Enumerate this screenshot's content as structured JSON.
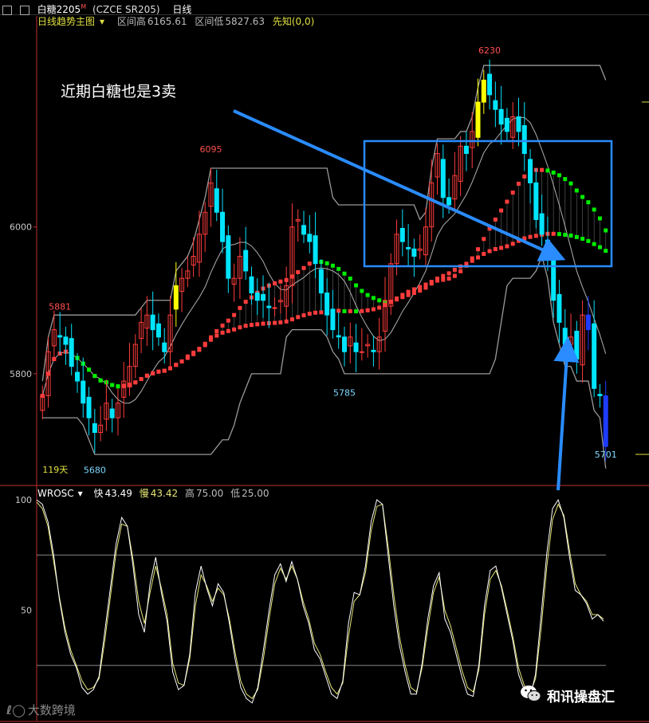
{
  "topbar": {
    "icons": [
      "grid-icon",
      "list-icon"
    ],
    "symbol": "白糖2205",
    "superscript": "M",
    "code": "(CZCE SR205)",
    "period": "日线"
  },
  "main_legend": {
    "indicator": "日线趋势主图",
    "range_high_label": "区间高",
    "range_high": "6165.61",
    "range_low_label": "区间低",
    "range_low": "5827.63",
    "extra": "先知(0,0)"
  },
  "headline": "近期白糖也是3卖",
  "osc_legend": {
    "name": "WROSC",
    "fast_label": "快",
    "fast": "43.49",
    "slow_label": "慢",
    "slow": "43.42",
    "high_label": "高",
    "high": "75.00",
    "low_label": "低",
    "low": "25.00"
  },
  "watermark": "和讯操盘汇",
  "watermark_small": "大数跨境",
  "colors": {
    "up": "#ff3c3c",
    "down": "#00e5ff",
    "yellow": "#ffff00",
    "blue_bar": "#1e3cff",
    "green": "#00ee00",
    "gray": "#a0a0a0",
    "box": "#2a8cff",
    "osc_fast": "#ffffff",
    "osc_slow": "#e6e678"
  },
  "chart_data": [
    {
      "type": "candlestick",
      "ylim": [
        5650,
        6270
      ],
      "y_ticks": [
        {
          "v": 6000,
          "label": "6000"
        },
        {
          "v": 5800,
          "label": "5800"
        }
      ],
      "annotations": [
        {
          "text": "6230",
          "i": 77,
          "v": 6230,
          "side": "top"
        },
        {
          "text": "6095",
          "i": 29,
          "v": 6095,
          "side": "top"
        },
        {
          "text": "5881",
          "i": 3,
          "v": 5881,
          "side": "top"
        },
        {
          "text": "5785",
          "i": 52,
          "v": 5785,
          "side": "bottom"
        },
        {
          "text": "5680",
          "i": 9,
          "v": 5680,
          "side": "bottom"
        },
        {
          "text": "5701",
          "i": 97,
          "v": 5701,
          "side": "bottom"
        },
        {
          "text": "119天",
          "i": 0,
          "v": 5665,
          "side": "raw"
        }
      ],
      "closes": [
        5770,
        5830,
        5860,
        5850,
        5840,
        5810,
        5790,
        5760,
        5740,
        5720,
        5730,
        5760,
        5740,
        5760,
        5790,
        5810,
        5840,
        5870,
        5880,
        5860,
        5850,
        5830,
        5880,
        5920,
        5930,
        5940,
        5960,
        5990,
        6020,
        6060,
        6020,
        5980,
        5930,
        5930,
        5960,
        5940,
        5910,
        5900,
        5900,
        5890,
        5890,
        5900,
        5920,
        6000,
        6010,
        5990,
        5980,
        5950,
        5910,
        5880,
        5860,
        5850,
        5830,
        5850,
        5830,
        5830,
        5840,
        5830,
        5850,
        5900,
        5950,
        5990,
        5980,
        5970,
        5960,
        5970,
        6000,
        6060,
        6100,
        6040,
        6030,
        6070,
        6110,
        6100,
        6130,
        6170,
        6200,
        6180,
        6160,
        6140,
        6130,
        6150,
        6130,
        6100,
        6060,
        6010,
        5990,
        5960,
        5900,
        5870,
        5840,
        5850,
        5820,
        5880,
        5860,
        5780,
        5770,
        5701
      ]
    },
    {
      "type": "line",
      "ylim": [
        0,
        100
      ],
      "y_ticks": [
        {
          "v": 100,
          "label": "100"
        },
        {
          "v": 50,
          "label": "50"
        }
      ],
      "hlines": [
        75,
        25
      ],
      "series": [
        {
          "name": "快",
          "values": [
            100,
            98,
            90,
            75,
            55,
            40,
            30,
            24,
            15,
            12,
            14,
            20,
            40,
            60,
            80,
            92,
            88,
            70,
            48,
            40,
            62,
            74,
            58,
            45,
            22,
            14,
            16,
            30,
            58,
            70,
            60,
            52,
            62,
            58,
            44,
            28,
            15,
            10,
            8,
            15,
            32,
            50,
            66,
            71,
            63,
            72,
            64,
            52,
            44,
            32,
            28,
            20,
            12,
            10,
            18,
            44,
            58,
            57,
            70,
            90,
            100,
            98,
            75,
            52,
            34,
            22,
            12,
            12,
            26,
            46,
            61,
            67,
            46,
            40,
            30,
            20,
            12,
            11,
            25,
            52,
            68,
            70,
            60,
            48,
            36,
            21,
            14,
            10,
            21,
            48,
            76,
            96,
            100,
            92,
            74,
            59,
            57,
            53,
            46,
            48,
            45
          ]
        },
        {
          "name": "慢",
          "values": [
            99,
            96,
            88,
            72,
            56,
            42,
            32,
            25,
            18,
            14,
            15,
            19,
            36,
            56,
            76,
            89,
            88,
            73,
            54,
            44,
            58,
            70,
            60,
            48,
            26,
            17,
            16,
            28,
            52,
            66,
            61,
            54,
            60,
            57,
            46,
            31,
            18,
            12,
            10,
            14,
            28,
            46,
            62,
            69,
            64,
            70,
            64,
            54,
            46,
            35,
            30,
            22,
            15,
            12,
            17,
            38,
            54,
            57,
            67,
            86,
            97,
            98,
            79,
            57,
            38,
            25,
            15,
            13,
            24,
            42,
            58,
            65,
            50,
            43,
            33,
            23,
            15,
            13,
            23,
            48,
            64,
            68,
            61,
            50,
            38,
            24,
            16,
            12,
            19,
            42,
            70,
            91,
            98,
            93,
            77,
            62,
            57,
            54,
            48,
            48,
            46
          ]
        }
      ]
    }
  ]
}
